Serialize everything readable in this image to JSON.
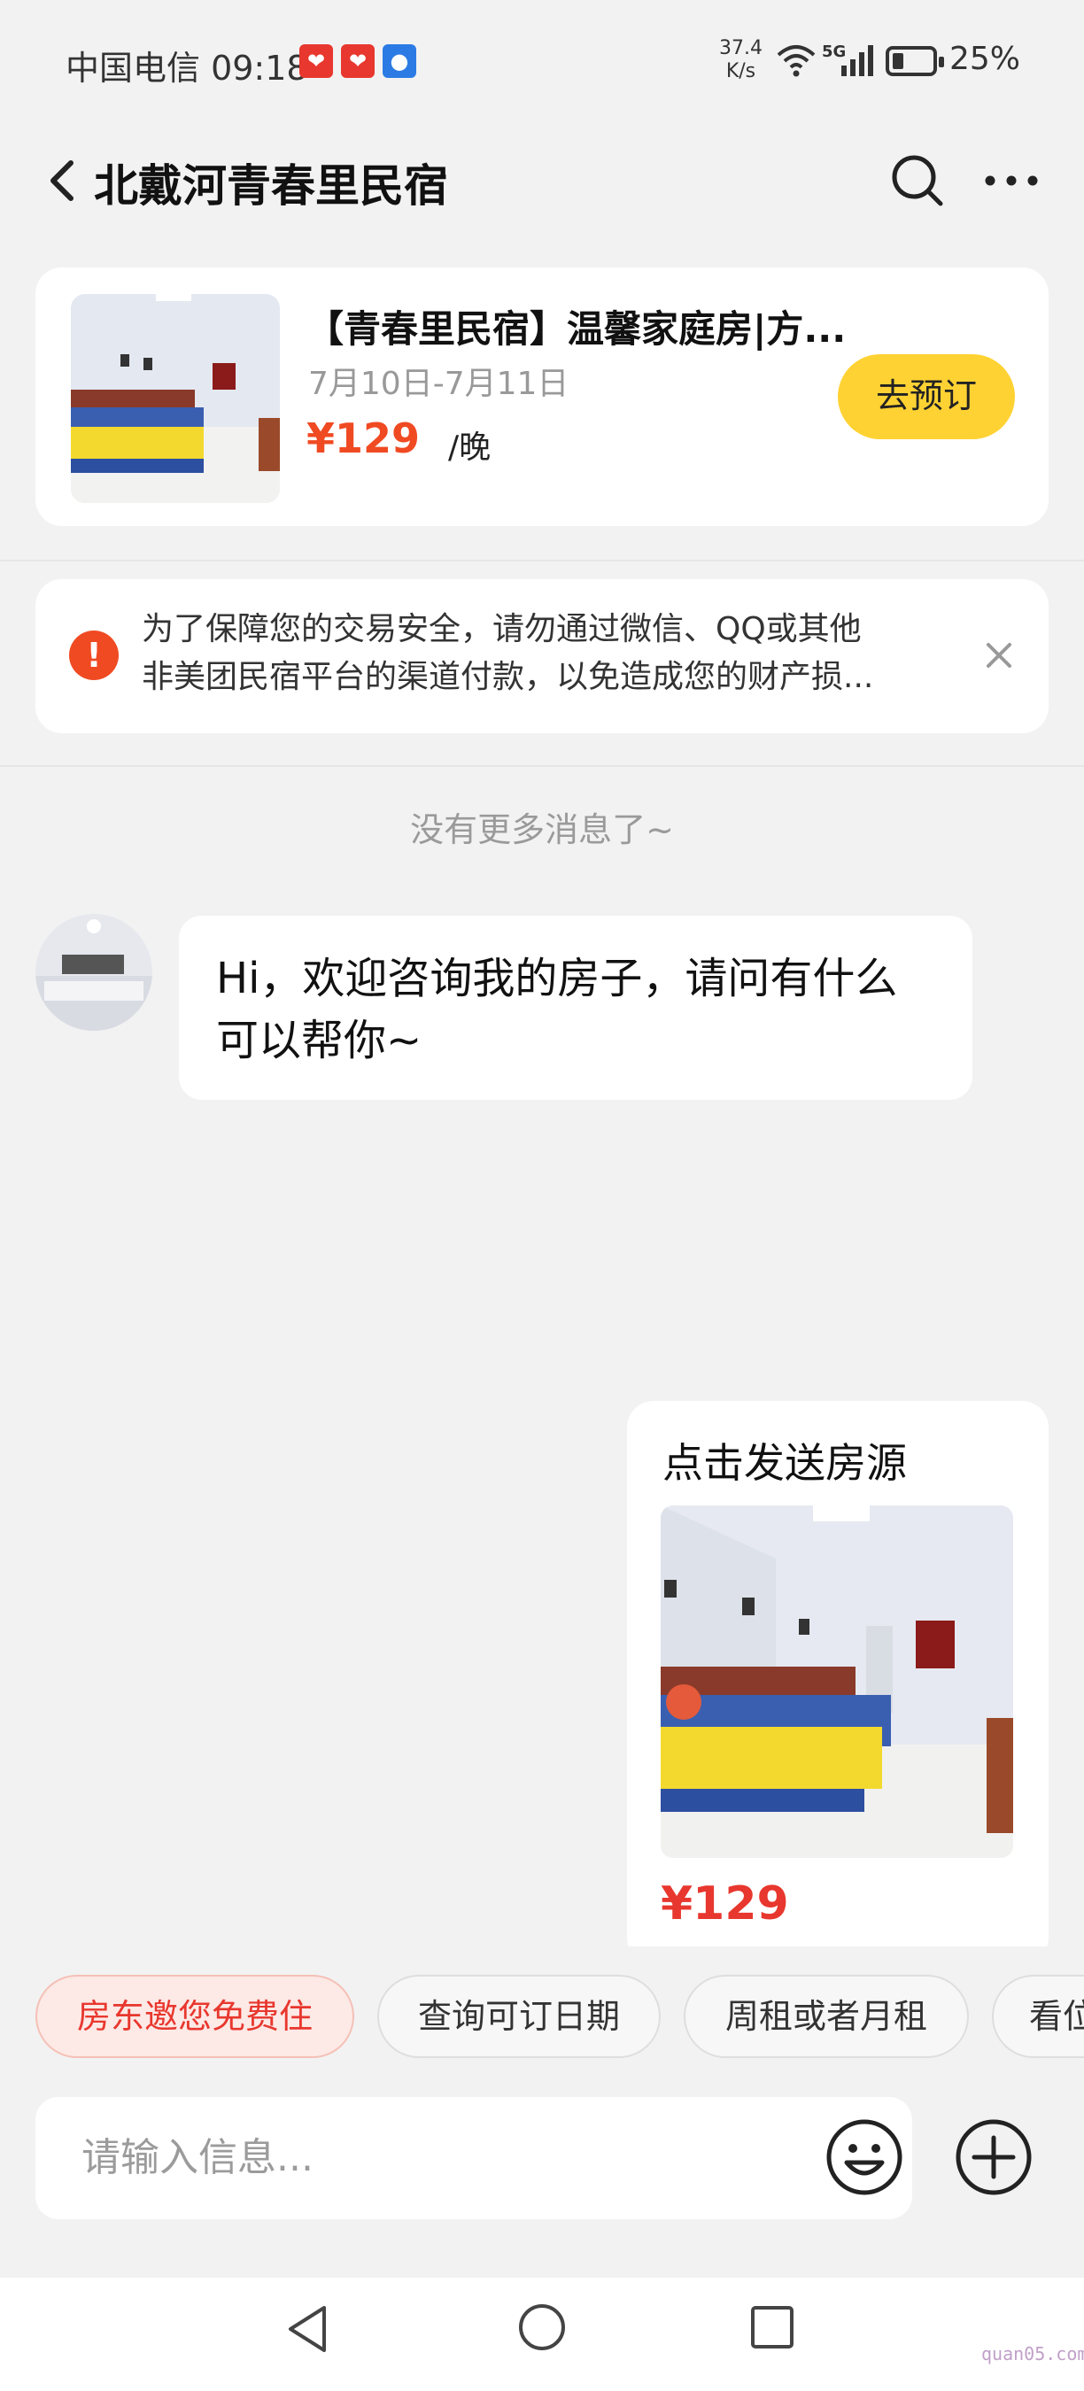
{
  "status_bar": {
    "carrier_time": "中国电信 09:18",
    "speed_value": "37.4",
    "speed_unit": "K/s",
    "network": "5G",
    "battery": "25%",
    "icons": [
      "notification-app-icon",
      "notification-app-icon",
      "notification-app-icon",
      "wifi-icon",
      "signal-icon",
      "battery-icon"
    ]
  },
  "header": {
    "title": "北戴河青春里民宿",
    "back_icon": "chevron-left-icon",
    "search_icon": "search-icon",
    "more_icon": "more-icon"
  },
  "listing": {
    "title": "【青春里民宿】温馨家庭房|方...",
    "dates": "7月10日-7月11日",
    "price": "¥129",
    "unit": "/晚",
    "book_label": "去预订"
  },
  "warning": {
    "line1": "为了保障您的交易安全，请勿通过微信、QQ或其他",
    "line2": "非美团民宿平台的渠道付款，以免造成您的财产损...",
    "icon": "exclamation-icon",
    "close_icon": "close-icon"
  },
  "chat": {
    "no_more": "没有更多消息了~",
    "host_message": "Hi，欢迎咨询我的房子，请问有什么可以帮你~",
    "send_card": {
      "title": "点击发送房源",
      "price": "¥129"
    }
  },
  "chips": [
    "房东邀您免费住",
    "查询可订日期",
    "周租或者月租",
    "看位置"
  ],
  "input": {
    "placeholder": "请输入信息...",
    "emoji_icon": "emoji-icon",
    "add_icon": "plus-circle-icon"
  },
  "nav": {
    "icons": [
      "nav-back-icon",
      "nav-home-icon",
      "nav-recent-icon"
    ]
  },
  "watermark": "quan05.com",
  "colors": {
    "accent_orange": "#f04a22",
    "button_yellow": "#ffd233",
    "price_red": "#e8372e",
    "background": "#f2f2f2"
  }
}
